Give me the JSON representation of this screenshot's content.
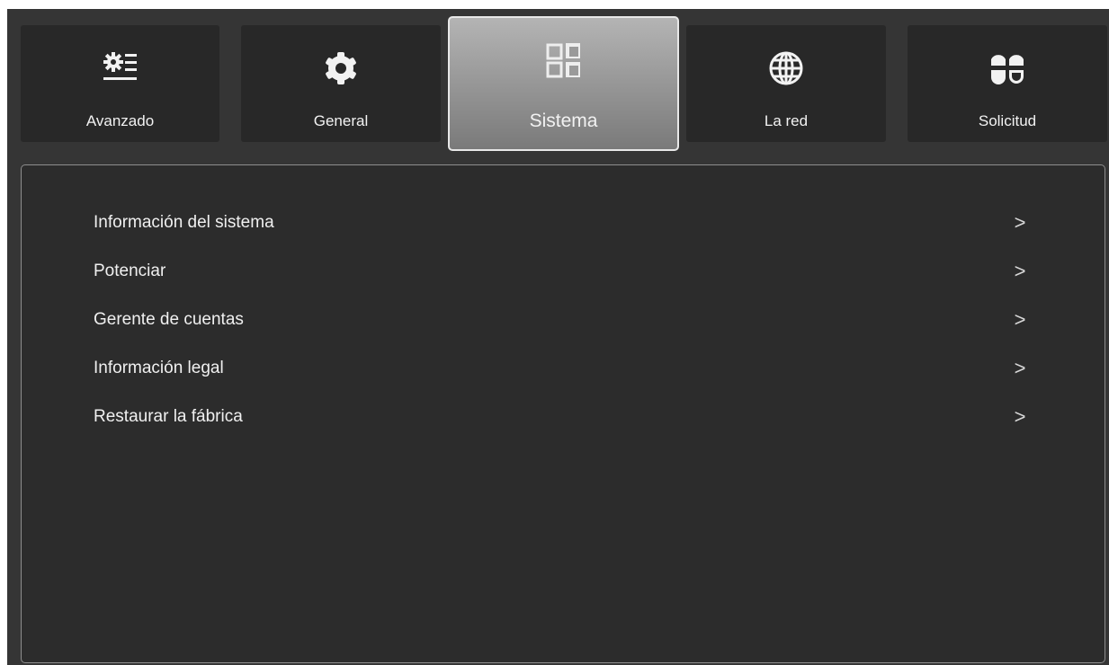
{
  "tabs": [
    {
      "label": "Avanzado",
      "icon": "advanced-settings-icon",
      "active": false
    },
    {
      "label": "General",
      "icon": "gear-icon",
      "active": false
    },
    {
      "label": "Sistema",
      "icon": "system-windows-icon",
      "active": true
    },
    {
      "label": "La red",
      "icon": "globe-icon",
      "active": false
    },
    {
      "label": "Solicitud",
      "icon": "apps-icon",
      "active": false
    }
  ],
  "menu": {
    "items": [
      {
        "label": "Información del sistema",
        "chevron": ">"
      },
      {
        "label": "Potenciar",
        "chevron": ">"
      },
      {
        "label": "Gerente de cuentas",
        "chevron": ">"
      },
      {
        "label": "Información legal",
        "chevron": ">"
      },
      {
        "label": "Restaurar la fábrica",
        "chevron": ">"
      }
    ]
  },
  "colors": {
    "background": "#353535",
    "tab": "#282828",
    "active_tab_top": "#b4b4b4",
    "active_tab_bottom": "#7a7a7a",
    "panel": "#2c2c2c",
    "text": "#f0f0f0"
  }
}
